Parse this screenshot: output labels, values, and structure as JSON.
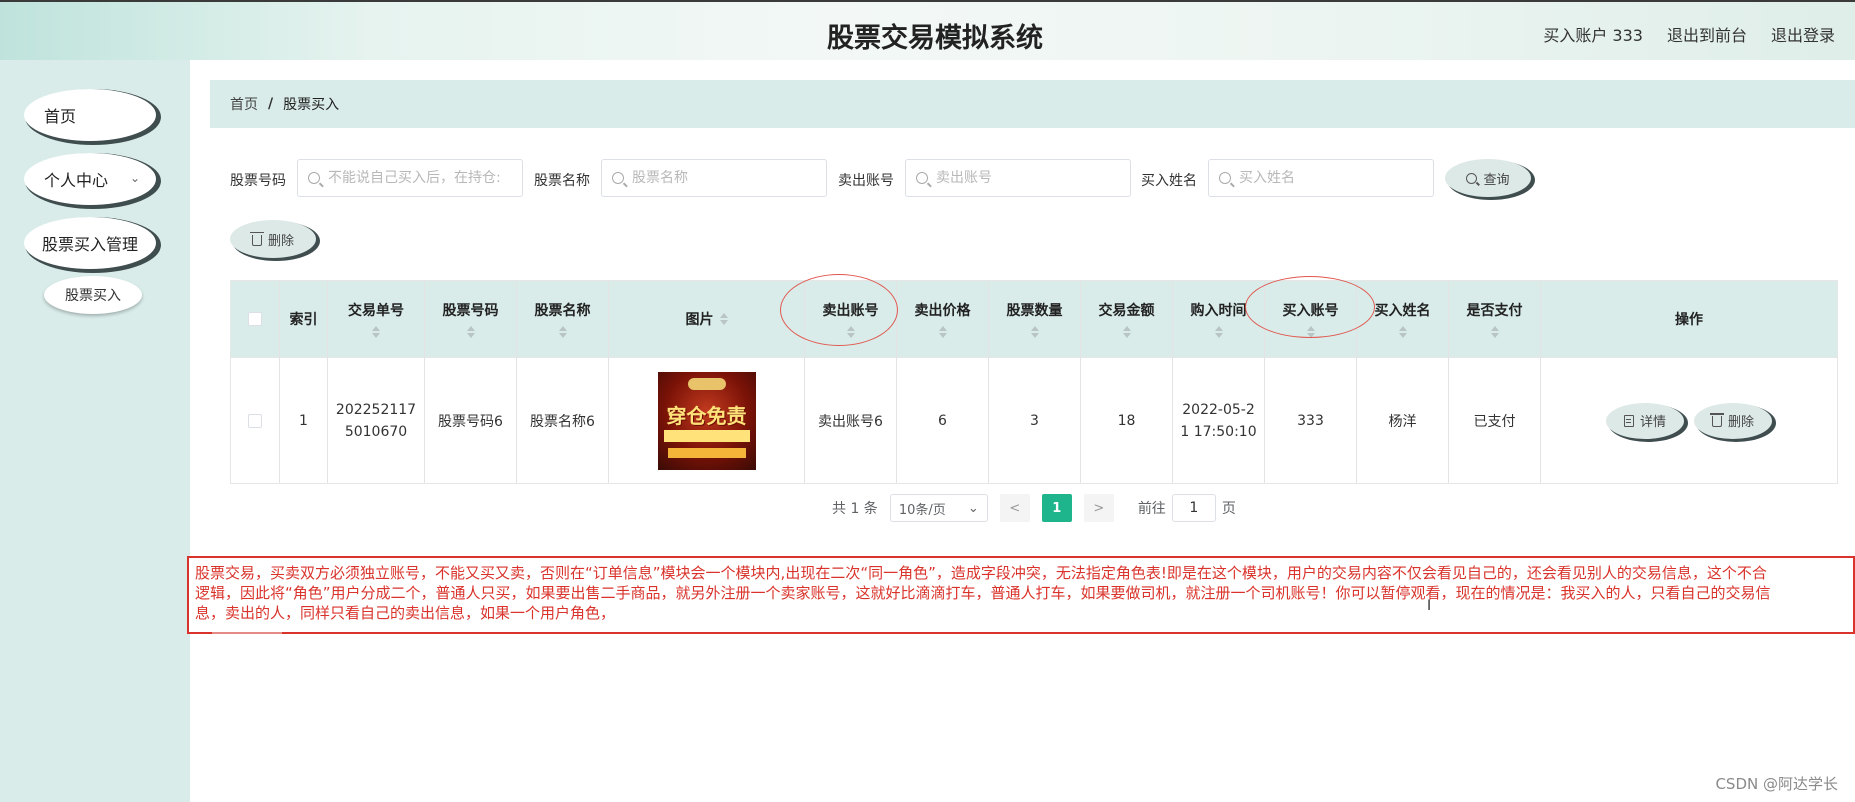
{
  "header": {
    "title": "股票交易模拟系统",
    "account": "买入账户 333",
    "front_link": "退出到前台",
    "logout_link": "退出登录"
  },
  "sidebar": {
    "items": [
      {
        "label": "首页"
      },
      {
        "label": "个人中心"
      },
      {
        "label": "股票买入管理"
      },
      {
        "label": "股票买入"
      }
    ]
  },
  "breadcrumb": {
    "home": "首页",
    "separator": "/",
    "current": "股票买入"
  },
  "search": {
    "fields": [
      {
        "label": "股票号码",
        "placeholder": "不能说自己买入后，在持仓:"
      },
      {
        "label": "股票名称",
        "placeholder": "股票名称"
      },
      {
        "label": "卖出账号",
        "placeholder": "卖出账号"
      },
      {
        "label": "买入姓名",
        "placeholder": "买入姓名"
      }
    ],
    "query_label": "查询",
    "delete_label": "删除"
  },
  "table": {
    "headers": [
      "索引",
      "交易单号",
      "股票号码",
      "股票名称",
      "图片",
      "卖出账号",
      "卖出价格",
      "股票数量",
      "交易金额",
      "购入时间",
      "买入账号",
      "买入姓名",
      "是否支付",
      "操作"
    ],
    "rows": [
      {
        "index": "1",
        "order_no": "202252117 5010670",
        "stock_code": "股票号码6",
        "stock_name": "股票名称6",
        "image_text": "穿仓免责",
        "seller_account": "卖出账号6",
        "price": "6",
        "quantity": "3",
        "amount": "18",
        "time": "2022-05-2 1 17:50:10",
        "buyer_account": "333",
        "buyer_name": "杨洋",
        "paid": "已支付",
        "detail_label": "详情",
        "delete_label": "删除"
      }
    ]
  },
  "pagination": {
    "total": "共 1 条",
    "page_size": "10条/页",
    "prev": "<",
    "current_page": "1",
    "next": ">",
    "goto_prefix": "前往",
    "goto_value": "1",
    "goto_suffix": "页"
  },
  "note": {
    "line1": "股票交易，买卖双方必须独立账号，不能又买又卖，否则在“订单信息”模块会一个模块内,出现在二次“同一角色”，造成字段冲突，无法指定角色表!即是在这个模块，用户的交易内容不仅会看见自己的，还会看见别人的交易信息，这个不合",
    "line2": "逻辑，因此将“角色”用户分成二个，普通人只买，如果要出售二手商品，就另外注册一个卖家账号，这就好比滴滴打车，普通人打车，如果要做司机，就注册一个司机账号！你可以暂停观看，现在的情况是：我买入的人，只看自己的交易信",
    "line3": "息，卖出的人，同样只看自己的卖出信息，如果一个用户角色，"
  },
  "watermark": "CSDN @阿达学长",
  "colors": {
    "accent": "#1fb58c",
    "sidebar_bg": "#d9ecea",
    "note_red": "#d9332b"
  }
}
